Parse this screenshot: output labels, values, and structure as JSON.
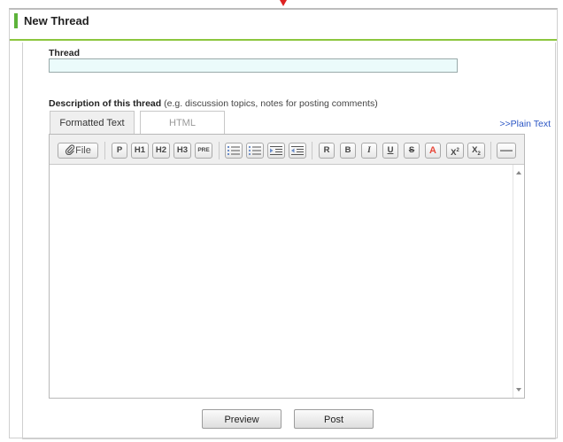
{
  "header": {
    "title": "New Thread"
  },
  "form": {
    "thread_label": "Thread",
    "thread_value": "",
    "description_label": "Description of this thread",
    "description_hint": " (e.g. discussion topics, notes for posting comments)",
    "tabs": [
      "Formatted Text",
      "HTML"
    ],
    "active_tab": "Formatted Text",
    "plain_text_link": ">>Plain Text"
  },
  "toolbar": {
    "file": "File",
    "p": "P",
    "h1": "H1",
    "h2": "H2",
    "h3": "H3",
    "pre": "PRE",
    "bold_r": "R",
    "bold": "B",
    "italic": "I",
    "underline": "U",
    "strike": "S",
    "font_color": "A",
    "superscript": "X",
    "subscript": "X"
  },
  "icons": [
    "paperclip-icon",
    "ordered-list-icon",
    "unordered-list-icon",
    "indent-icon",
    "outdent-icon",
    "horizontal-rule-icon",
    "scroll-up-icon",
    "scroll-down-icon"
  ],
  "colors": {
    "accent_green": "#8cc63e",
    "link_blue": "#2a55c4",
    "font_color_red": "#e8493b"
  },
  "actions": {
    "preview": "Preview",
    "post": "Post"
  }
}
